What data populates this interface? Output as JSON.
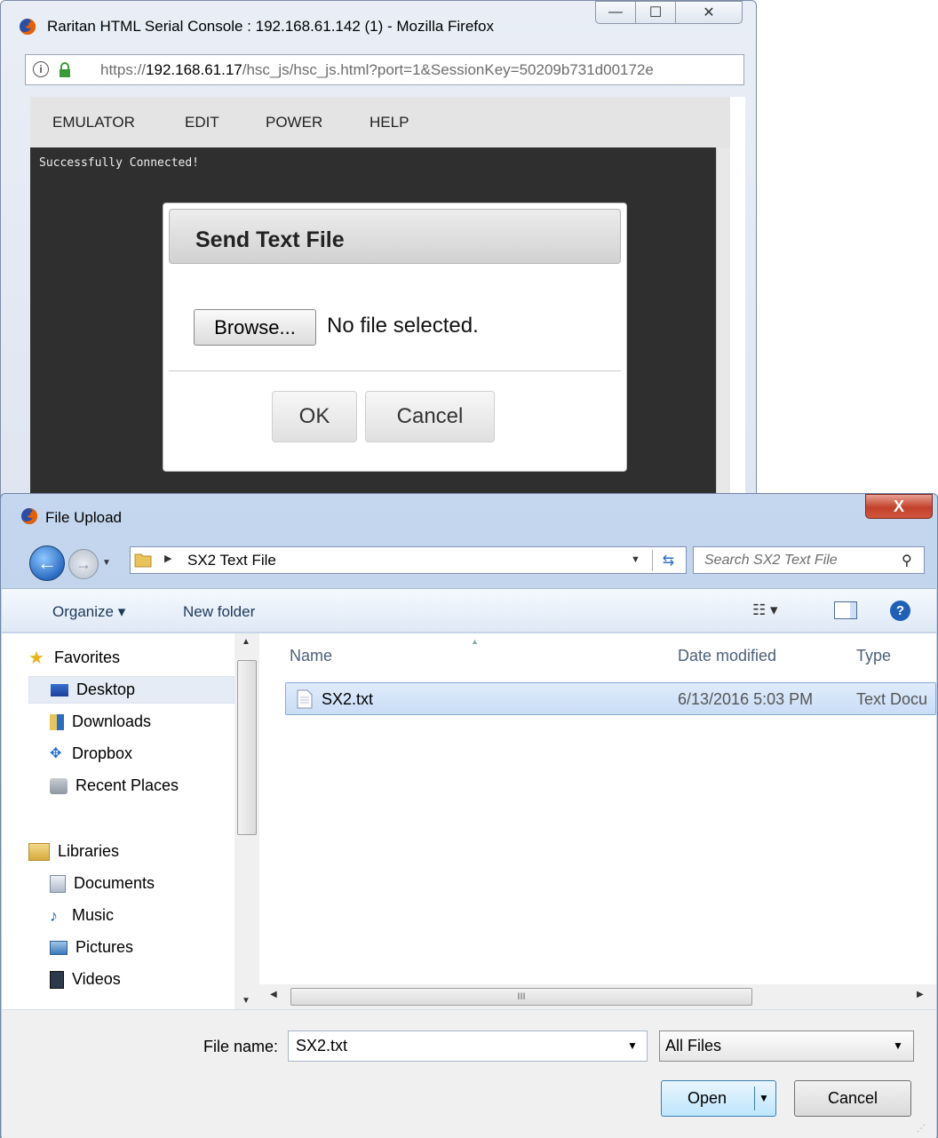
{
  "browser": {
    "title": "Raritan HTML Serial Console : 192.168.61.142 (1) - Mozilla Firefox",
    "url_prefix": "https://",
    "url_host": "192.168.61.17",
    "url_path": "/hsc_js/hsc_js.html?port=1&SessionKey=50209b731d00172e",
    "controls": {
      "minimize": "—",
      "maximize": "☐",
      "close": "✕"
    }
  },
  "console": {
    "menu": [
      "EMULATOR",
      "EDIT",
      "POWER",
      "HELP"
    ],
    "terminal_text": "Successfully Connected!"
  },
  "send_text_file": {
    "title": "Send Text File",
    "browse_label": "Browse...",
    "no_file": "No file selected.",
    "ok_label": "OK",
    "cancel_label": "Cancel"
  },
  "file_upload": {
    "title": "File Upload",
    "close_label": "X",
    "address": {
      "arrow": "▶",
      "path": "SX2 Text File",
      "dropdown": "▼"
    },
    "search_placeholder": "Search SX2 Text File",
    "toolbar": {
      "organize": "Organize ▾",
      "new_folder": "New folder",
      "views": "☷ ▾",
      "help": "?"
    },
    "nav": {
      "favorites_label": "Favorites",
      "favorites": [
        "Desktop",
        "Downloads",
        "Dropbox",
        "Recent Places"
      ],
      "libraries_label": "Libraries",
      "libraries": [
        "Documents",
        "Music",
        "Pictures",
        "Videos"
      ]
    },
    "columns": {
      "name": "Name",
      "date": "Date modified",
      "type": "Type"
    },
    "files": [
      {
        "name": "SX2.txt",
        "date": "6/13/2016 5:03 PM",
        "type": "Text Docu"
      }
    ],
    "hscroll_grip": "III",
    "file_name_label": "File name:",
    "file_name_value": "SX2.txt",
    "file_type_value": "All Files",
    "open_label": "Open",
    "cancel_label": "Cancel"
  },
  "colors": {
    "terminal_bg": "#2f2f2f",
    "accent_blue": "#1e5fb8",
    "selection": "#c9ddf6"
  }
}
